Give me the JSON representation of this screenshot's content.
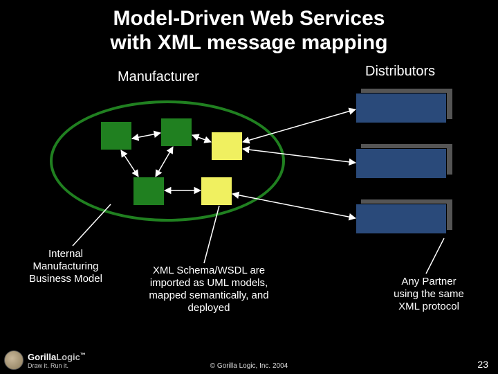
{
  "title_line1": "Model-Driven Web Services",
  "title_line2": "with XML message mapping",
  "manufacturer_label": "Manufacturer",
  "distributors_label": "Distributors",
  "internal_label_l1": "Internal",
  "internal_label_l2": "Manufacturing",
  "internal_label_l3": "Business Model",
  "xml_label_l1": "XML Schema/WSDL are",
  "xml_label_l2": "imported as UML models,",
  "xml_label_l3": "mapped semantically, and",
  "xml_label_l4": "deployed",
  "partner_label_l1": "Any Partner",
  "partner_label_l2": "using the same",
  "partner_label_l3": "XML protocol",
  "logo_brand_a": "Gorilla",
  "logo_brand_b": "Logic",
  "logo_tm": "™",
  "logo_tagline": "Draw it. Run it.",
  "copyright": "© Gorilla Logic, Inc. 2004",
  "page_number": "23"
}
